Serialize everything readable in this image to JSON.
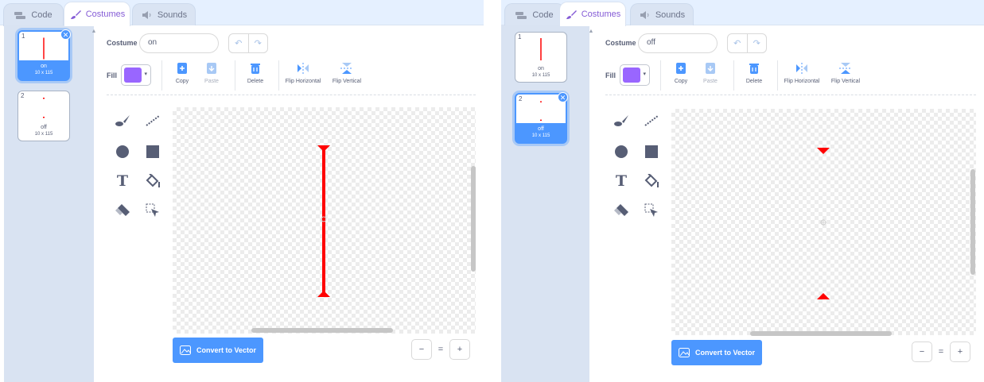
{
  "colors": {
    "accent": "#4c97ff",
    "purple": "#855cd6",
    "fill": "#9966ff",
    "art": "#ff0000"
  },
  "panels": [
    {
      "tabs": [
        {
          "label": "Code",
          "icon": "code-blocks-icon"
        },
        {
          "label": "Costumes",
          "icon": "paintbrush-icon"
        },
        {
          "label": "Sounds",
          "icon": "speaker-icon"
        }
      ],
      "costumes": [
        {
          "number": "1",
          "name": "on",
          "dimensions": "10 x 115",
          "selected": true
        },
        {
          "number": "2",
          "name": "off",
          "dimensions": "10 x 115",
          "selected": false
        }
      ],
      "editor": {
        "costume_label": "Costume",
        "costume_name": "on",
        "fill_label": "Fill",
        "tools": {
          "copy": "Copy",
          "paste": "Paste",
          "delete": "Delete",
          "flip_horizontal": "Flip Horizontal",
          "flip_vertical": "Flip Vertical"
        },
        "convert_label": "Convert to Vector",
        "zoom": {
          "zoom_out": "−",
          "reset": "=",
          "zoom_in": "+"
        }
      }
    },
    {
      "tabs": [
        {
          "label": "Code",
          "icon": "code-blocks-icon"
        },
        {
          "label": "Costumes",
          "icon": "paintbrush-icon"
        },
        {
          "label": "Sounds",
          "icon": "speaker-icon"
        }
      ],
      "costumes": [
        {
          "number": "1",
          "name": "on",
          "dimensions": "10 x 115",
          "selected": false
        },
        {
          "number": "2",
          "name": "off",
          "dimensions": "10 x 115",
          "selected": true
        }
      ],
      "editor": {
        "costume_label": "Costume",
        "costume_name": "off",
        "fill_label": "Fill",
        "tools": {
          "copy": "Copy",
          "paste": "Paste",
          "delete": "Delete",
          "flip_horizontal": "Flip Horizontal",
          "flip_vertical": "Flip Vertical"
        },
        "convert_label": "Convert to Vector",
        "zoom": {
          "zoom_out": "−",
          "reset": "=",
          "zoom_in": "+"
        }
      }
    }
  ]
}
